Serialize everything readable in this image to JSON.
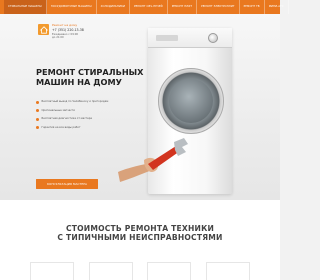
{
  "nav": {
    "items": [
      {
        "label": "Стиральные машины",
        "active": true
      },
      {
        "label": "Посудомоечные машины",
        "active": false
      },
      {
        "label": "Холодильники",
        "active": false
      },
      {
        "label": "Ремонт СВЧ-печей",
        "active": false
      },
      {
        "label": "Ремонт плит",
        "active": false
      },
      {
        "label": "Ремонт электроплит",
        "active": false
      },
      {
        "label": "Ремонт ТВ",
        "active": false
      },
      {
        "label": "Мини-АТС",
        "active": false
      }
    ]
  },
  "brand": {
    "tag": "Ремонт на дому",
    "phone": "+7 (351) 220-13-38",
    "hours": "Ежедневно с 09:00 до 21:00"
  },
  "hero": {
    "headline": "Ремонт стиральных машин на дому",
    "features": [
      "Бесплатный выезд по Челябинску и пригородам",
      "Оригинальные запчасти",
      "Бесплатная диагностика от мастера",
      "Гарантия на все виды работ"
    ],
    "cta_label": "Консультация мастера"
  },
  "pricing": {
    "title_line1": "Стоимость ремонта техники",
    "title_line2": "с типичными неисправностями"
  },
  "colors": {
    "accent": "#e9781f",
    "accent_dark": "#c9621a"
  }
}
